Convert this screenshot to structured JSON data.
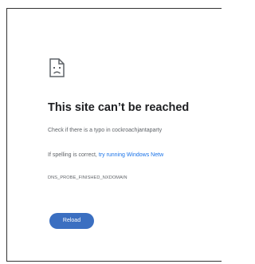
{
  "error_page": {
    "icon": "sad-document-icon",
    "title": "This site can’t be reached",
    "line1": "Check if there is a typo in cockroachjantaparty",
    "line2_prefix": "If spelling is correct, ",
    "line2_link": "try running Windows Netw",
    "error_code": "DNS_PROBE_FINISHED_NXDOMAIN",
    "reload_label": "Reload"
  },
  "colors": {
    "accent": "#3b6fc1",
    "link": "#1a73e8",
    "title": "#202124",
    "text": "#5f6368"
  }
}
